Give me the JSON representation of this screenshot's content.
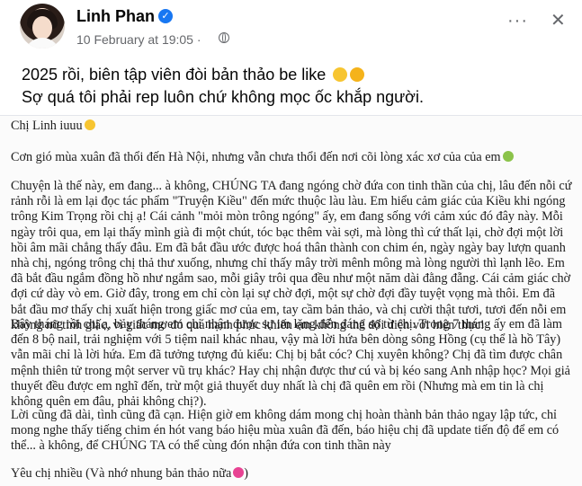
{
  "post": {
    "author": "Linh Phan",
    "date": "10 February at 19:05 ·",
    "more_label": "···",
    "close_label": "✕",
    "caption_line1": "2025 rồi, biên tập viên đòi bản thảo be like",
    "caption_line2": "Sợ quá tôi phải rep luôn chứ không mọc ốc khắp người."
  },
  "letter": {
    "p1": "Chị Linh iuuu",
    "p2": "Cơn gió mùa xuân đã thổi đến Hà Nội, nhưng vẫn chưa thổi đến nơi cõi lòng xác xơ của của em",
    "p3": "Chuyện là thế này, em đang... à không, CHÚNG TA đang ngóng chờ đứa con tinh thần của chị, lâu đến nỗi cứ rảnh rỗi là em lại đọc tác phẩm \"Truyện Kiều\" đến mức thuộc làu làu. Em hiểu cảm giác của Kiều khi ngóng trông Kim Trọng rồi chị ạ! Cái cảnh \"mỏi mòn trông ngóng\" ấy, em đang sống với cảm xúc đó đây này. Mỗi ngày trôi qua, em lại thấy mình già đi một chút, tóc bạc thêm vài sợi, mà lòng thì cứ thất lại, chờ đợi một lời hồi âm mãi chẳng thấy đâu. Em đã bắt đầu ước được hoá thân thành con chim én, ngày ngày bay lượn quanh nhà chị, ngóng trông chị thả thư xuống, nhưng chỉ thấy mây trời mênh mông mà lòng người thì lạnh lẽo. Em đã bắt đầu ngắm đồng hồ như ngắm sao, mỗi giây trôi qua đều như một năm dài đằng đẵng. Cái cảm giác chờ đợi cứ dày vò em. Giờ đây, trong em chỉ còn lại sự chờ đợi, một sự chờ đợi đầy tuyệt vọng mà thôi. Em đã bắt đầu mơ thấy chị xuất hiện trong giấc mơ của em, tay cầm bản thảo, và chị cười thật tươi, tươi đến nỗi em không nỡ tỉnh giấc, vì giấc mơ đó quá hạnh phúc khiến em không thể đối diện với hiện thực!",
    "p4": "Bây tháng rồi chị ạ, bảy tháng em chỉ nhận được sự im lặng đến đáng sợ từ chị. Trong 7 tháng ấy em đã làm đến 8 bộ nail, trải nghiệm với 5 tiệm nail khác nhau, vậy mà lời hứa bên dòng sông Hồng (cụ thể là hồ Tây) vẫn mãi chỉ là lời hứa. Em đã tưởng tượng đủ kiểu: Chị bị bắt cóc? Chị xuyên không? Chị đã tìm được chân mệnh thiên tử trong một server vũ trụ khác? Hay chị nhận được thư cú và bị kéo sang Anh nhập học? Mọi giả thuyết đều được em nghĩ đến, trừ một giả thuyết duy nhất là chị đã quên em rồi (Nhưng mà em tin là chị không quên em đâu, phải không chị?).",
    "p5": "Lời cũng đã dài, tình cũng đã cạn. Hiện giờ em không dám mong chị hoàn thành bản thảo ngay lập tức, chỉ mong nghe thấy tiếng chim én hót vang báo hiệu mùa xuân đã đến, báo hiệu chị đã update tiến độ để em có thể... à không, để CHÚNG TA có thể cùng đón nhận đứa con tinh thần này",
    "p6": "Yêu chị nhiều (Và nhớ nhung bản thảo nữa"
  },
  "colors": {
    "accent": "#1877f2",
    "muted": "#65676b"
  },
  "icons": [
    "verified-badge-icon",
    "globe-icon",
    "more-icon",
    "close-icon",
    "laughing-emoji-icon"
  ]
}
